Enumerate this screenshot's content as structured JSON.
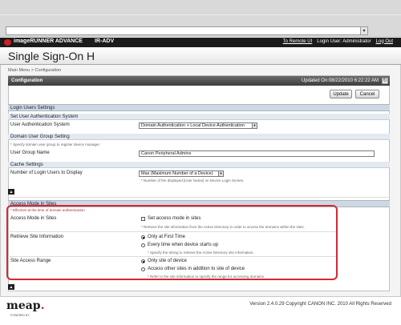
{
  "header": {
    "brand_name": "imageRUNNER ADVANCE",
    "app_name": "IR-ADV",
    "to_remote_ui": "To Remote UI",
    "login_user": "Login User: Administrator",
    "logout": "Log Out"
  },
  "page": {
    "title": "Single Sign-On H",
    "breadcrumb": "Main Menu > Configuration"
  },
  "config": {
    "title": "Configuration",
    "updated": "Updated On:08/22/2010 6:22:22 AM",
    "update_button": "Update",
    "cancel_button": "Cancel"
  },
  "login_users": {
    "section_title": "Login Users Settings",
    "auth": {
      "title": "Set User Authentication System",
      "label": "User Authentication System",
      "value": "Domain Authentication + Local Device Authentication"
    },
    "domain_group": {
      "title": "Domain User Group Setting",
      "note": "* Specify domain user group to register device manager.",
      "label": "User Group Name",
      "value": "Canon Peripheral Admins"
    },
    "cache": {
      "title": "Cache Settings",
      "label": "Number of Login Users to Display",
      "value": "Max (Maximum Number of a Device)",
      "note": "* Number of the displayed [User Name] on Device Login Screen."
    }
  },
  "access_mode": {
    "section_title": "Access Mode in Sites",
    "effective_note": "* Effective at the time of domain authentication",
    "access_label": "Access Mode in Sites",
    "set_access_label": "Set access mode in sites",
    "set_access_checked": false,
    "set_access_note": "* Retrieve the site information from the Active Directory in order to access the domains within the sites.",
    "retrieve_label": "Retrieve Site Information",
    "retrieve_opt1": "Only at First Time",
    "retrieve_opt2": "Every time when device starts up",
    "retrieve_note": "* Specify the timing to retrieve the Active Directory site information.",
    "range_label": "Site Access Range",
    "range_opt1": "Only site of device",
    "range_opt2": "Access other sites in addition to site of device",
    "range_note": "* Refer to the site information to specify the range for accessing domains."
  },
  "footer": {
    "logo": "meap",
    "powered": "POWERED BY",
    "copyright": "Version 2.4.0.29 Copyright CANON INC. 2010 All Rights Reserved"
  },
  "colors": {
    "highlight": "#d22a35",
    "brand_bar": "#1c1c1c",
    "section_bar": "#cfd8e2"
  }
}
